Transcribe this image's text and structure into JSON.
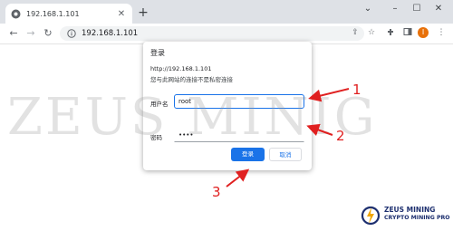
{
  "browser": {
    "tab_title": "192.168.1.101",
    "url": "192.168.1.101",
    "avatar_letter": "I",
    "icons": [
      "chrome-favicon",
      "tab-close-icon",
      "new-tab-icon",
      "tab-search-icon",
      "minimize-icon",
      "maximize-icon",
      "close-window-icon",
      "back-icon",
      "forward-icon",
      "reload-icon",
      "site-info-icon",
      "share-icon",
      "bookmark-star-icon",
      "extensions-icon",
      "side-panel-icon",
      "menu-kebab-icon"
    ]
  },
  "dialog": {
    "title": "登录",
    "url": "http://192.168.1.101",
    "warning": "您与此网站的连接不是私密连接",
    "username_label": "用户名",
    "username_value": "root",
    "password_label": "密码",
    "password_value": "••••",
    "login_button": "登录",
    "cancel_button": "取消"
  },
  "annotations": {
    "labels": [
      "1",
      "2",
      "3"
    ],
    "color": "#e02020"
  },
  "watermark": "ZEUS MINIG",
  "logo": {
    "line1": "ZEUS MINING",
    "line2": "CRYPTO MINING PRO"
  },
  "colors": {
    "accent": "#1a73e8",
    "avatar": "#e8710a",
    "logo": "#1d2f6f"
  }
}
